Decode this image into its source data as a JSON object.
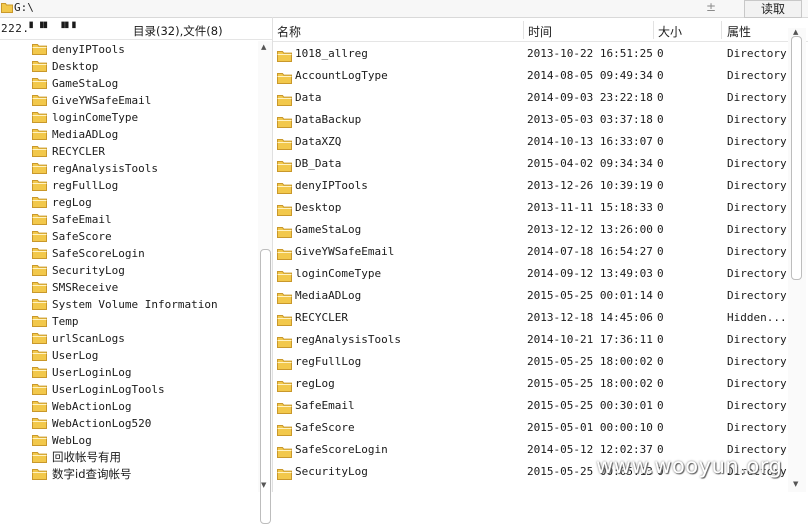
{
  "address": {
    "path": "G:\\",
    "updown_glyph": "±",
    "read_button": "读取"
  },
  "left_pane": {
    "ip_fragment": "222.▘▝▘ ▝▘▘",
    "summary": "目录(32),文件(8)",
    "tree": [
      "denyIPTools",
      "Desktop",
      "GameStaLog",
      "GiveYWSafeEmail",
      "loginComeType",
      "MediaADLog",
      "RECYCLER",
      "regAnalysisTools",
      "regFullLog",
      "regLog",
      "SafeEmail",
      "SafeScore",
      "SafeScoreLogin",
      "SecurityLog",
      "SMSReceive",
      "System Volume Information",
      "Temp",
      "urlScanLogs",
      "UserLog",
      "UserLoginLog",
      "UserLoginLogTools",
      "WebActionLog",
      "WebActionLog520",
      "WebLog",
      "回收帐号有用",
      "数字id查询帐号"
    ]
  },
  "columns": {
    "name": "名称",
    "time": "时间",
    "size": "大小",
    "attr": "属性"
  },
  "files": [
    {
      "name": "1018_allreg",
      "time": "2013-10-22 16:51:25",
      "size": "0",
      "attr": "Directory"
    },
    {
      "name": "AccountLogType",
      "time": "2014-08-05 09:49:34",
      "size": "0",
      "attr": "Directory"
    },
    {
      "name": "Data",
      "time": "2014-09-03 23:22:18",
      "size": "0",
      "attr": "Directory"
    },
    {
      "name": "DataBackup",
      "time": "2013-05-03 03:37:18",
      "size": "0",
      "attr": "Directory"
    },
    {
      "name": "DataXZQ",
      "time": "2014-10-13 16:33:07",
      "size": "0",
      "attr": "Directory"
    },
    {
      "name": "DB_Data",
      "time": "2015-04-02 09:34:34",
      "size": "0",
      "attr": "Directory"
    },
    {
      "name": "denyIPTools",
      "time": "2013-12-26 10:39:19",
      "size": "0",
      "attr": "Directory"
    },
    {
      "name": "Desktop",
      "time": "2013-11-11 15:18:33",
      "size": "0",
      "attr": "Directory"
    },
    {
      "name": "GameStaLog",
      "time": "2013-12-12 13:26:00",
      "size": "0",
      "attr": "Directory"
    },
    {
      "name": "GiveYWSafeEmail",
      "time": "2014-07-18 16:54:27",
      "size": "0",
      "attr": "Directory"
    },
    {
      "name": "loginComeType",
      "time": "2014-09-12 13:49:03",
      "size": "0",
      "attr": "Directory"
    },
    {
      "name": "MediaADLog",
      "time": "2015-05-25 00:01:14",
      "size": "0",
      "attr": "Directory"
    },
    {
      "name": "RECYCLER",
      "time": "2013-12-18 14:45:06",
      "size": "0",
      "attr": "Hidden..."
    },
    {
      "name": "regAnalysisTools",
      "time": "2014-10-21 17:36:11",
      "size": "0",
      "attr": "Directory"
    },
    {
      "name": "regFullLog",
      "time": "2015-05-25 18:00:02",
      "size": "0",
      "attr": "Directory"
    },
    {
      "name": "regLog",
      "time": "2015-05-25 18:00:02",
      "size": "0",
      "attr": "Directory"
    },
    {
      "name": "SafeEmail",
      "time": "2015-05-25 00:30:01",
      "size": "0",
      "attr": "Directory"
    },
    {
      "name": "SafeScore",
      "time": "2015-05-01 00:00:10",
      "size": "0",
      "attr": "Directory"
    },
    {
      "name": "SafeScoreLogin",
      "time": "2014-05-12 12:02:37",
      "size": "0",
      "attr": "Directory"
    },
    {
      "name": "SecurityLog",
      "time": "2015-05-25 00:05:13",
      "size": "0",
      "attr": "Directory"
    }
  ],
  "watermark": "www.wooyun.org",
  "colors": {
    "folder_fill": "#f2c84b",
    "folder_edge": "#c9982b"
  }
}
